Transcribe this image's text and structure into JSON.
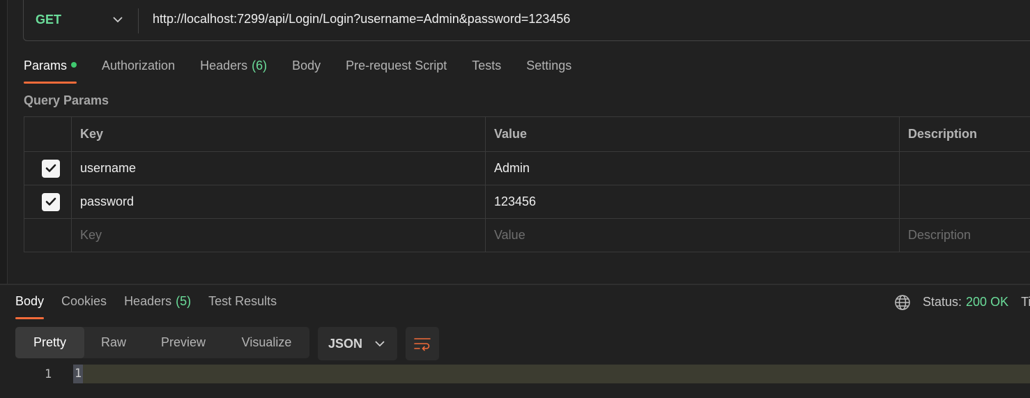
{
  "request": {
    "method": "GET",
    "url": "http://localhost:7299/api/Login/Login?username=Admin&password=123456"
  },
  "request_tabs": [
    {
      "label": "Params",
      "active": true,
      "dot": true
    },
    {
      "label": "Authorization"
    },
    {
      "label": "Headers",
      "count": "(6)"
    },
    {
      "label": "Body"
    },
    {
      "label": "Pre-request Script"
    },
    {
      "label": "Tests"
    },
    {
      "label": "Settings"
    }
  ],
  "query_params": {
    "title": "Query Params",
    "headers": {
      "key": "Key",
      "value": "Value",
      "description": "Description"
    },
    "rows": [
      {
        "checked": true,
        "key": "username",
        "value": "Admin",
        "description": ""
      },
      {
        "checked": true,
        "key": "password",
        "value": "123456",
        "description": ""
      }
    ],
    "placeholders": {
      "key": "Key",
      "value": "Value",
      "description": "Description"
    }
  },
  "response_tabs": [
    {
      "label": "Body",
      "active": true
    },
    {
      "label": "Cookies"
    },
    {
      "label": "Headers",
      "count": "(5)"
    },
    {
      "label": "Test Results"
    }
  ],
  "status": {
    "label": "Status:",
    "value": "200 OK",
    "truncated": "Ti"
  },
  "views": [
    {
      "label": "Pretty",
      "active": true
    },
    {
      "label": "Raw"
    },
    {
      "label": "Preview"
    },
    {
      "label": "Visualize"
    }
  ],
  "format": "JSON",
  "editor": {
    "line_number": "1",
    "content": "1"
  },
  "colors": {
    "accent": "#f26b3a",
    "success": "#6bdd9a",
    "background": "#212121"
  }
}
